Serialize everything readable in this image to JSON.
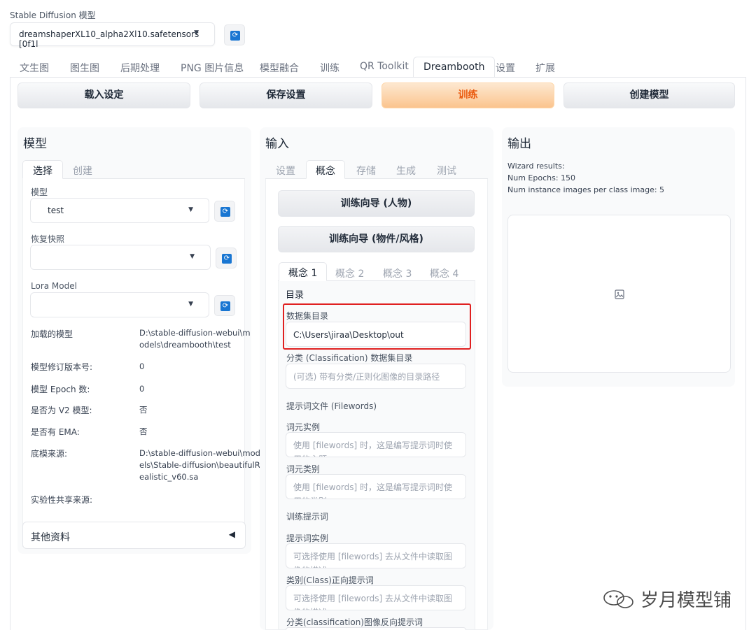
{
  "header": {
    "model_label": "Stable Diffusion 模型",
    "model_value": "dreamshaperXL10_alpha2Xl10.safetensors [0f1l",
    "refresh_icon": "refresh-icon"
  },
  "tabs": [
    "文生图",
    "图生图",
    "后期处理",
    "PNG 图片信息",
    "模型融合",
    "训练",
    "QR Toolkit",
    "Dreambooth",
    "设置",
    "扩展"
  ],
  "actions": {
    "load": "载入设定",
    "save": "保存设置",
    "train": "训练",
    "create": "创建模型"
  },
  "model_panel": {
    "title": "模型",
    "tabs": [
      "选择",
      "创建"
    ],
    "model_label": "模型",
    "model_value": "test",
    "snapshot_label": "恢复快照",
    "lora_label": "Lora Model",
    "info": [
      {
        "key": "加载的模型",
        "value": "D:\\stable-diffusion-webui\\models\\dreambooth\\test"
      },
      {
        "key": "模型修订版本号:",
        "value": "0"
      },
      {
        "key": "模型 Epoch 数:",
        "value": "0"
      },
      {
        "key": "是否为 V2 模型:",
        "value": "否"
      },
      {
        "key": "是否有 EMA:",
        "value": "否"
      },
      {
        "key": "底模来源:",
        "value": "D:\\stable-diffusion-webui\\models\\Stable-diffusion\\beautifulRealistic_v60.sa"
      },
      {
        "key": "实验性共享来源:",
        "value": ""
      }
    ],
    "other_info": "其他资料"
  },
  "input_panel": {
    "title": "输入",
    "tabs": [
      "设置",
      "概念",
      "存储",
      "生成",
      "测试"
    ],
    "wizard_person": "训练向导 (人物)",
    "wizard_object": "训练向导 (物件/风格)",
    "concept_tabs": [
      "概念 1",
      "概念 2",
      "概念 3",
      "概念 4"
    ],
    "directory_heading": "目录",
    "dataset_label": "数据集目录",
    "dataset_value": "C:\\Users\\jiraa\\Desktop\\out",
    "class_dataset_label": "分类 (Classification) 数据集目录",
    "class_dataset_placeholder": "(可选) 带有分类/正则化图像的目录路径",
    "filewords_heading": "提示词文件 (Filewords)",
    "instance_token_label": "词元实例",
    "instance_token_placeholder": "使用 [filewords] 时，这是编写提示词时使用的主题",
    "class_token_label": "词元类别",
    "class_token_placeholder": "使用 [filewords] 时，这是编写提示词时使用的类别",
    "train_prompts_heading": "训练提示词",
    "instance_prompt_label": "提示词实例",
    "instance_prompt_placeholder": "可选择使用 [filewords] 去从文件中读取图像的描述",
    "class_prompt_label": "类别(Class)正向提示词",
    "class_prompt_placeholder": "可选择使用 [filewords] 去从文件中读取图像的描述",
    "class_negative_label": "分类(classification)图像反向提示词"
  },
  "output_panel": {
    "title": "输出",
    "lines": [
      "Wizard results:",
      "Num Epochs: 150",
      "Num instance images per class image: 5"
    ],
    "image_icon": "image-icon"
  },
  "watermark": "岁月模型铺"
}
